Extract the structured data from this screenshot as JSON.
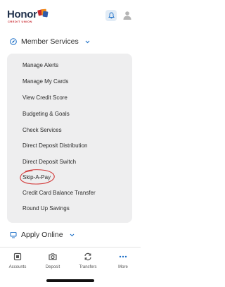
{
  "brand": {
    "name": "Honor",
    "tagline": "CREDIT UNION"
  },
  "header": {
    "notifications_icon": "bell-icon",
    "profile_icon": "user-icon"
  },
  "member_services": {
    "label": "Member Services",
    "icon": "compass-icon",
    "items": [
      "Manage Alerts",
      "Manage My Cards",
      "View Credit Score",
      "Budgeting & Goals",
      "Check Services",
      "Direct Deposit Distribution",
      "Direct Deposit Switch",
      "Skip-A-Pay",
      "Credit Card Balance Transfer",
      "Round Up Savings"
    ],
    "highlighted_item": "Skip-A-Pay"
  },
  "apply_online": {
    "label": "Apply Online",
    "icon": "monitor-icon"
  },
  "tabs": [
    {
      "label": "Accounts",
      "icon": "accounts-icon"
    },
    {
      "label": "Deposit",
      "icon": "camera-icon"
    },
    {
      "label": "Transfers",
      "icon": "transfer-icon"
    },
    {
      "label": "More",
      "icon": "more-dots-icon"
    }
  ],
  "colors": {
    "accent": "#1c6fc7",
    "brand_navy": "#1f2f4a",
    "brand_red": "#c8272e",
    "annotation": "#d23a3a",
    "panel": "#eeeeef"
  }
}
